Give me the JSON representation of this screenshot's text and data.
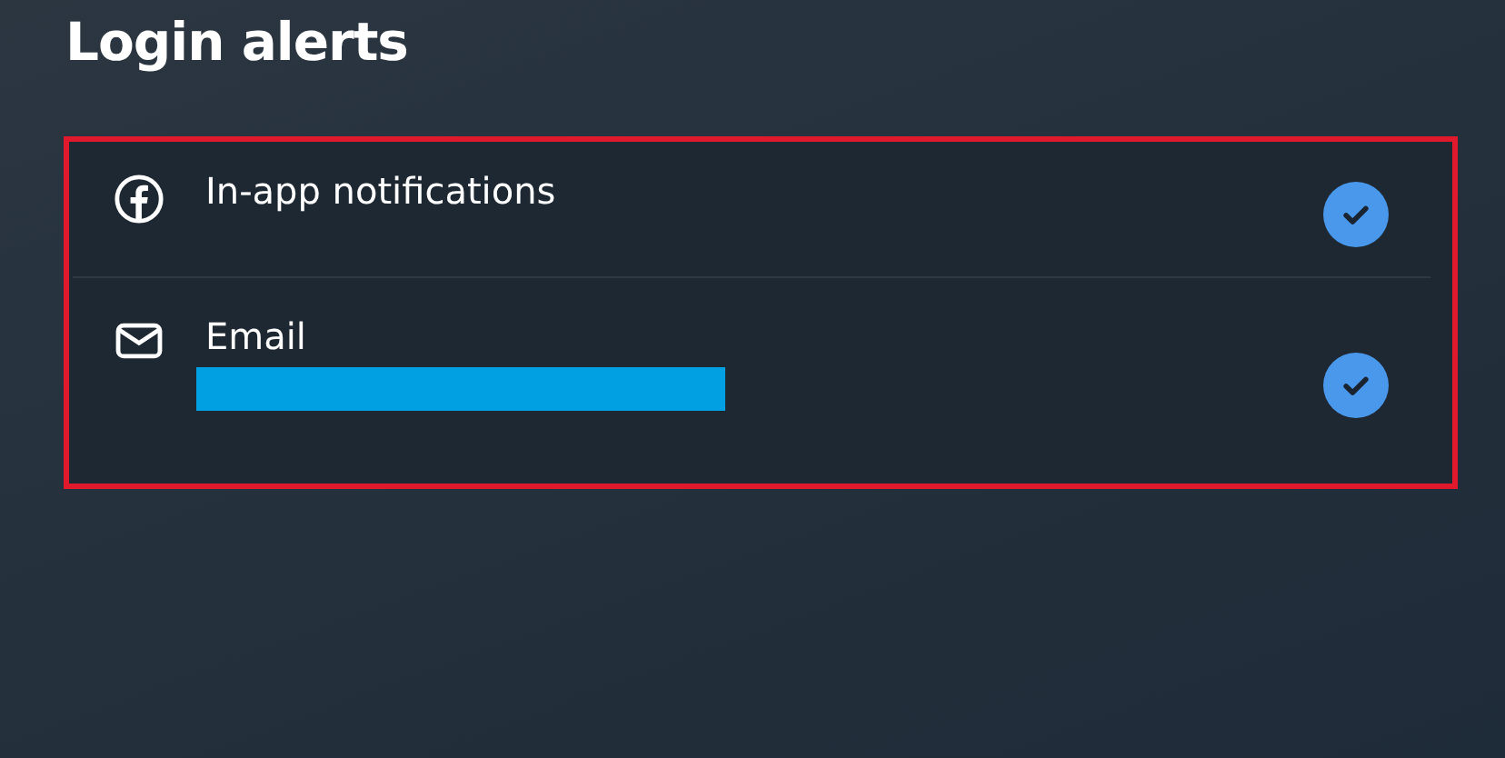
{
  "title": "Login alerts",
  "highlight": {
    "color": "#e0192c"
  },
  "channels": [
    {
      "kind": "app",
      "label": "In-app notifications",
      "redacted": false,
      "checked": true
    },
    {
      "kind": "email",
      "label": "Email",
      "redacted": true,
      "checked": true
    }
  ]
}
